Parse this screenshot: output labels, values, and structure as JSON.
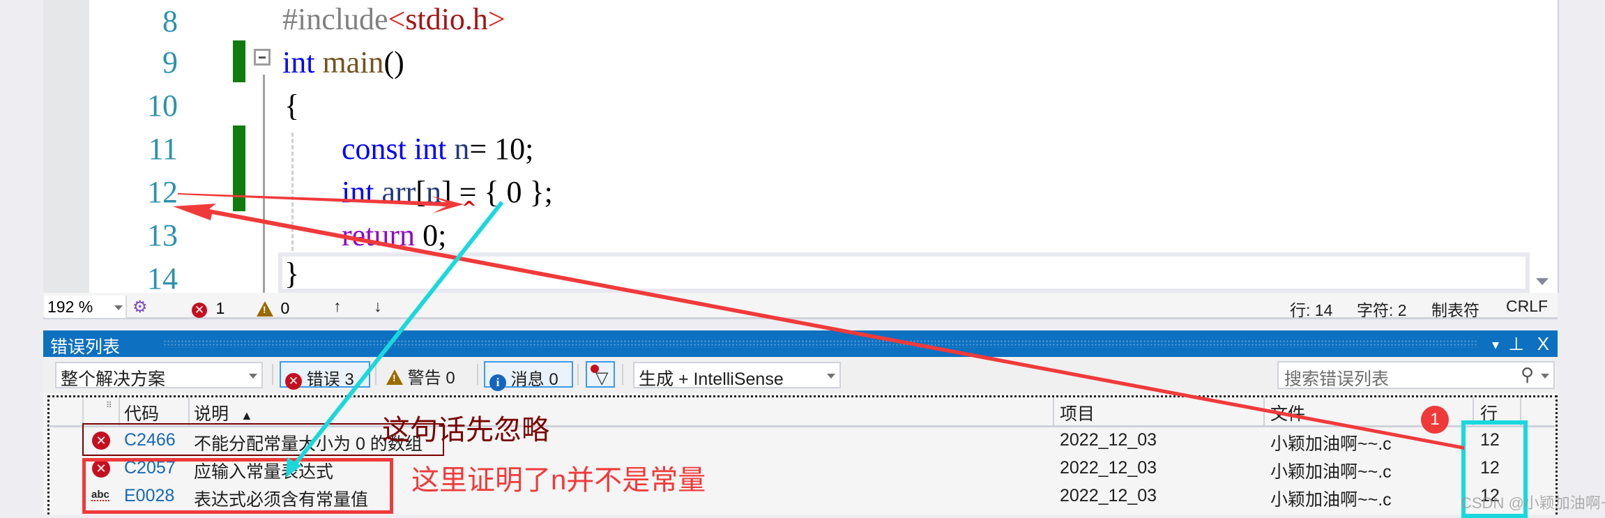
{
  "editor": {
    "line_numbers": [
      "8",
      "9",
      "10",
      "11",
      "12",
      "13",
      "14"
    ],
    "lines": {
      "l8": {
        "pp": "#include",
        "lt": "<",
        "hdr": "stdio.h",
        "gt": ">"
      },
      "l9": {
        "kw": "int",
        "fn": "main",
        "rest": "()"
      },
      "l10": {
        "text": "{"
      },
      "l11": {
        "kw1": "const",
        "kw2": "int",
        "var": "n",
        "rest": "= 10;"
      },
      "l12": {
        "kw": "int",
        "arr": "arr",
        "lb": "[",
        "var": "n",
        "rest": "] = { 0 };"
      },
      "l13": {
        "kw": "return",
        "rest": " 0;"
      },
      "l14": {
        "text": "}"
      }
    },
    "squiggle": "^"
  },
  "status_bar": {
    "zoom": "192 %",
    "errors": "1",
    "warnings": "0",
    "up_arrow": "↑",
    "down_arrow": "↓",
    "line": "行: 14",
    "char": "字符: 2",
    "indent": "制表符",
    "eol": "CRLF"
  },
  "error_list": {
    "title": "错误列表",
    "title_buttons": {
      "dropdown": "▾",
      "pin": "⊥",
      "close": "X"
    },
    "scope": "整个解决方案",
    "errors_btn": "错误 3",
    "warnings_btn": "警告 0",
    "messages_btn": "消息 0",
    "source": "生成 + IntelliSense",
    "search_placeholder": "搜索错误列表",
    "columns": {
      "code": "代码",
      "desc": "说明",
      "sort": "▲",
      "project": "项目",
      "file": "文件",
      "line": "行"
    },
    "rows": [
      {
        "type": "error",
        "code": "C2466",
        "desc": "不能分配常量大小为 0 的数组",
        "project": "2022_12_03",
        "file": "小颖加油啊~~.c",
        "line": "12"
      },
      {
        "type": "error",
        "code": "C2057",
        "desc": "应输入常量表达式",
        "project": "2022_12_03",
        "file": "小颖加油啊~~.c",
        "line": "12"
      },
      {
        "type": "intellisense",
        "code": "E0028",
        "desc": "表达式必须含有常量值",
        "project": "2022_12_03",
        "file": "小颖加油啊~~.c",
        "line": "12"
      }
    ]
  },
  "annotations": {
    "ignore_note": "这句话先忽略",
    "proof_note": "这里证明了n并不是常量",
    "badge": "1",
    "colors": {
      "red": "#f03a3a",
      "dark_red": "#7a0000",
      "cyan": "#1ad8dc"
    }
  },
  "watermark": "CSDN @小颖加油啊~~"
}
